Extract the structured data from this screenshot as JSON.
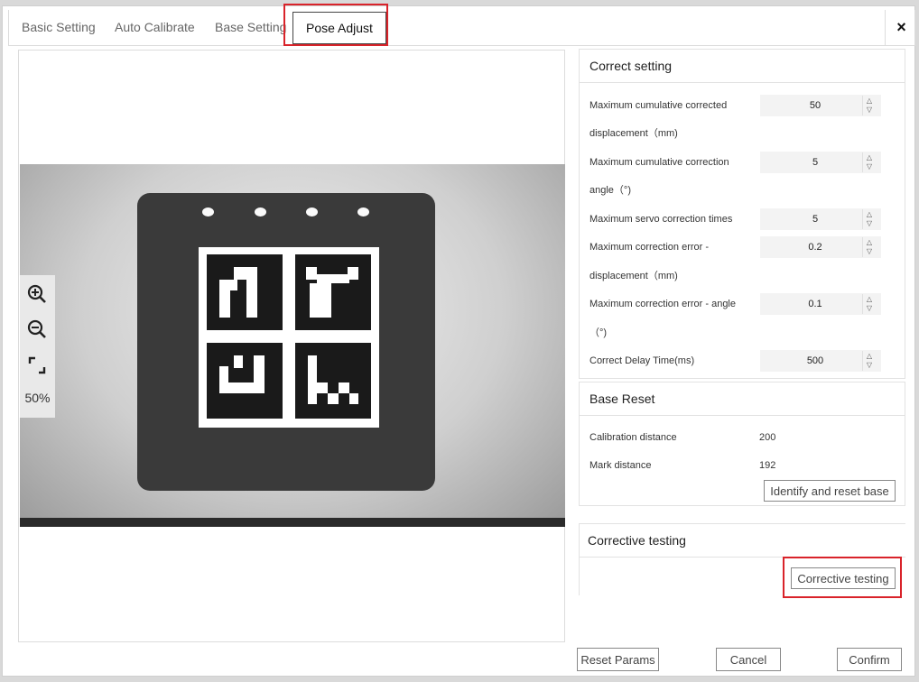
{
  "tabs": [
    {
      "label": "Basic Setting"
    },
    {
      "label": "Auto Calibrate"
    },
    {
      "label": "Base Setting"
    },
    {
      "label": "Pose Adjust"
    }
  ],
  "close_label": "×",
  "viewer": {
    "zoom_level": "50%"
  },
  "correct_setting": {
    "title": "Correct setting",
    "fields": [
      {
        "label_line1": "Maximum cumulative corrected",
        "label_line2": "displacement（mm)",
        "value": "50"
      },
      {
        "label_line1": "Maximum cumulative correction",
        "label_line2": "angle（°)",
        "value": "5"
      },
      {
        "label_line1": "Maximum servo correction times",
        "label_line2": "",
        "value": "5"
      },
      {
        "label_line1": "Maximum correction error -",
        "label_line2": "displacement（mm)",
        "value": "0.2"
      },
      {
        "label_line1": "Maximum correction error - angle",
        "label_line2": "（°)",
        "value": "0.1"
      },
      {
        "label_line1": "Correct Delay Time(ms)",
        "label_line2": "",
        "value": "500"
      }
    ]
  },
  "base_reset": {
    "title": "Base Reset",
    "calibration_distance_label": "Calibration distance",
    "calibration_distance_value": "200",
    "mark_distance_label": "Mark distance",
    "mark_distance_value": "192",
    "identify_button": "Identify and reset base"
  },
  "corrective_testing": {
    "title": "Corrective testing",
    "button": "Corrective testing"
  },
  "footer": {
    "reset_params": "Reset Params",
    "cancel": "Cancel",
    "confirm": "Confirm"
  },
  "colors": {
    "highlight": "#d9232a"
  }
}
